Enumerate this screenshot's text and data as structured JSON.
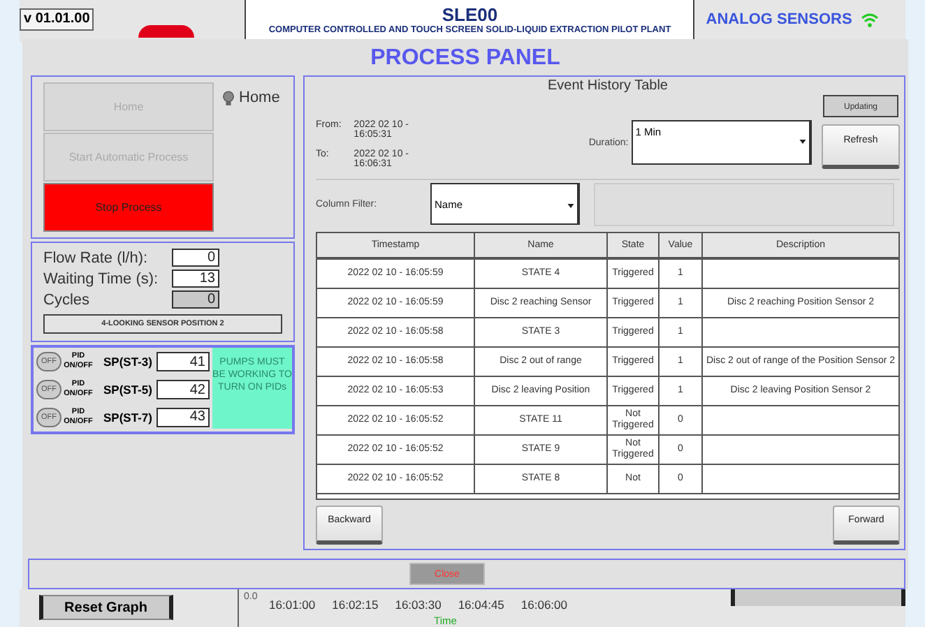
{
  "background": {
    "version": "v 01.01.00",
    "title": "SLE00",
    "subtitle": "COMPUTER CONTROLLED AND TOUCH SCREEN SOLID-LIQUID EXTRACTION PILOT PLANT",
    "section": "ANALOG SENSORS",
    "reset_button": "Reset Graph",
    "time_axis": {
      "y_value": "0.0",
      "ticks": [
        "16:01:00",
        "16:02:15",
        "16:03:30",
        "16:04:45",
        "16:06:00"
      ],
      "label": "Time"
    }
  },
  "dialog": {
    "title": "PROCESS PANEL",
    "controls": [
      {
        "label": "Home",
        "kind": "plain",
        "disabled": true
      },
      {
        "label": "Start Automatic Process",
        "kind": "plain",
        "disabled": true
      },
      {
        "label": "Stop Process",
        "kind": "stop",
        "disabled": false
      }
    ],
    "home_indicator": {
      "label": "Home",
      "on": false
    },
    "parameters": [
      {
        "label": "Flow Rate (l/h):",
        "value": "0",
        "disabled": false
      },
      {
        "label": "Waiting Time (s):",
        "value": "13",
        "disabled": false
      },
      {
        "label": "Cycles",
        "value": "0",
        "disabled": true
      }
    ],
    "status": "4-LOOKING SENSOR POSITION 2",
    "pids": [
      {
        "switch": "OFF",
        "on": false,
        "caption": "PID",
        "caption_2": "ON/OFF",
        "setpoint_label": "SP(ST-3)",
        "value": "41"
      },
      {
        "switch": "OFF",
        "on": false,
        "caption": "PID",
        "caption_2": "ON/OFF",
        "setpoint_label": "SP(ST-5)",
        "value": "42"
      },
      {
        "switch": "OFF",
        "on": false,
        "caption": "PID",
        "caption_2": "ON/OFF",
        "setpoint_label": "SP(ST-7)",
        "value": "43"
      }
    ],
    "pid_warning": "PUMPS MUST BE WORKING TO TURN ON PIDs",
    "events": {
      "title": "Event History Table",
      "updating": "Updating",
      "from_label": "From:",
      "from": "2022 02 10 - 16:05:31",
      "to_label": "To:",
      "to": "2022 02 10 - 16:06:31",
      "duration_label": "Duration:",
      "duration": "1 Min",
      "refresh": "Refresh",
      "filter_label": "Column Filter:",
      "filter": "Name",
      "columns": [
        "Timestamp",
        "Name",
        "State",
        "Value",
        "Description"
      ],
      "rows": [
        [
          "2022 02 10 - 16:05:59",
          "STATE 4",
          "Triggered",
          "1",
          ""
        ],
        [
          "2022 02 10 - 16:05:59",
          "Disc 2 reaching Sensor",
          "Triggered",
          "1",
          "Disc 2 reaching Position Sensor 2"
        ],
        [
          "2022 02 10 - 16:05:58",
          "STATE 3",
          "Triggered",
          "1",
          ""
        ],
        [
          "2022 02 10 - 16:05:58",
          "Disc 2 out of range",
          "Triggered",
          "1",
          "Disc 2 out of range of the Position Sensor 2"
        ],
        [
          "2022 02 10 - 16:05:53",
          "Disc 2 leaving Position",
          "Triggered",
          "1",
          "Disc 2 leaving Position Sensor 2"
        ],
        [
          "2022 02 10 - 16:05:52",
          "STATE 11",
          "Not Triggered",
          "0",
          ""
        ],
        [
          "2022 02 10 - 16:05:52",
          "STATE 9",
          "Not Triggered",
          "0",
          ""
        ],
        [
          "2022 02 10 - 16:05:52",
          "STATE 8",
          "Not",
          "0",
          ""
        ]
      ],
      "backward": "Backward",
      "forward": "Forward"
    },
    "close": "Close"
  }
}
